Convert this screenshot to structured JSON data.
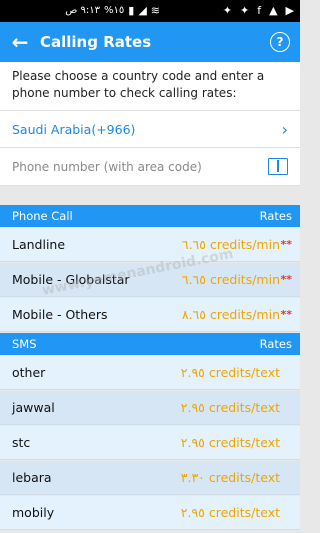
{
  "status_bar": {
    "time": "٩:١٣ ص",
    "battery": "%١٥",
    "icons": [
      "signal-icon",
      "wifi-icon",
      "facebook-icon",
      "twitter-icon",
      "twitter-icon",
      "facebook-icon",
      "drive-icon",
      "video-icon"
    ]
  },
  "appbar": {
    "title": "Calling Rates",
    "back_icon": "arrow-left-icon",
    "help_label": "?"
  },
  "instruction": "Please choose a country code and enter a phone number to check calling rates:",
  "country": {
    "label": "Saudi Arabia(+966)"
  },
  "phone": {
    "placeholder": "Phone number (with area code)",
    "value": ""
  },
  "phone_call": {
    "header_left": "Phone Call",
    "header_right": "Rates",
    "rows": [
      {
        "name": "Landline",
        "rate": "٦.٦٥ credits/min",
        "flag": "**"
      },
      {
        "name": "Mobile - Globalstar",
        "rate": "٦.٦٥ credits/min",
        "flag": "**"
      },
      {
        "name": "Mobile - Others",
        "rate": "٨.٦٥ credits/min",
        "flag": "**"
      }
    ]
  },
  "sms": {
    "header_left": "SMS",
    "header_right": "Rates",
    "rows": [
      {
        "name": "other",
        "rate": "٢.٩٥ credits/text"
      },
      {
        "name": "jawwal",
        "rate": "٢.٩٥ credits/text"
      },
      {
        "name": "stc",
        "rate": "٢.٩٥ credits/text"
      },
      {
        "name": "lebara",
        "rate": "٣.٣٠ credits/text"
      },
      {
        "name": "mobily",
        "rate": "٢.٩٥ credits/text"
      }
    ]
  },
  "watermark": "www.yemenandroid.com",
  "colors": {
    "primary": "#2196f3",
    "row_bg": "#e3f2fd",
    "row_alt_bg": "#d6e6f4",
    "rate_text": "#f0a500",
    "star": "#e53935",
    "link": "#1e88e5"
  }
}
